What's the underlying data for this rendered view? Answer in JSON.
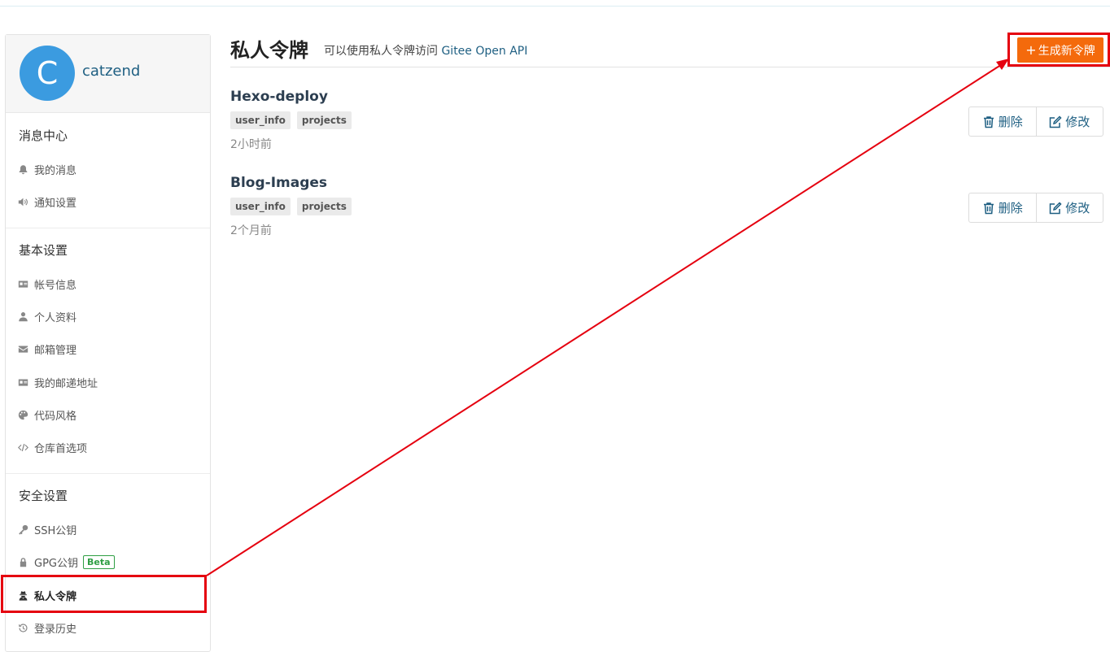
{
  "user": {
    "avatar_letter": "C",
    "name": "catzend"
  },
  "sidebar": {
    "sections": [
      {
        "title": "消息中心",
        "items": [
          {
            "label": "我的消息",
            "icon": "bell-icon"
          },
          {
            "label": "通知设置",
            "icon": "volume-icon"
          }
        ]
      },
      {
        "title": "基本设置",
        "items": [
          {
            "label": "帐号信息",
            "icon": "id-card-icon"
          },
          {
            "label": "个人资料",
            "icon": "user-icon"
          },
          {
            "label": "邮箱管理",
            "icon": "envelope-icon"
          },
          {
            "label": "我的邮递地址",
            "icon": "address-card-icon"
          },
          {
            "label": "代码风格",
            "icon": "palette-icon"
          },
          {
            "label": "仓库首选项",
            "icon": "code-icon"
          }
        ]
      },
      {
        "title": "安全设置",
        "items": [
          {
            "label": "SSH公钥",
            "icon": "key-icon"
          },
          {
            "label": "GPG公钥",
            "icon": "lock-icon",
            "badge": "Beta"
          },
          {
            "label": "私人令牌",
            "icon": "user-secret-icon",
            "active": true
          },
          {
            "label": "登录历史",
            "icon": "history-icon"
          }
        ]
      }
    ]
  },
  "header": {
    "title": "私人令牌",
    "subtitle_prefix": "可以使用私人令牌访问",
    "subtitle_link": "Gitee Open API",
    "generate_button": "生成新令牌"
  },
  "tokens": [
    {
      "name": "Hexo-deploy",
      "scopes": [
        "user_info",
        "projects"
      ],
      "time": "2小时前"
    },
    {
      "name": "Blog-Images",
      "scopes": [
        "user_info",
        "projects"
      ],
      "time": "2个月前"
    }
  ],
  "actions": {
    "delete": "删除",
    "edit": "修改"
  },
  "colors": {
    "accent": "#f46a0c",
    "link": "#1e5f82",
    "annotation": "#e5000f",
    "avatar": "#3b9be0"
  }
}
